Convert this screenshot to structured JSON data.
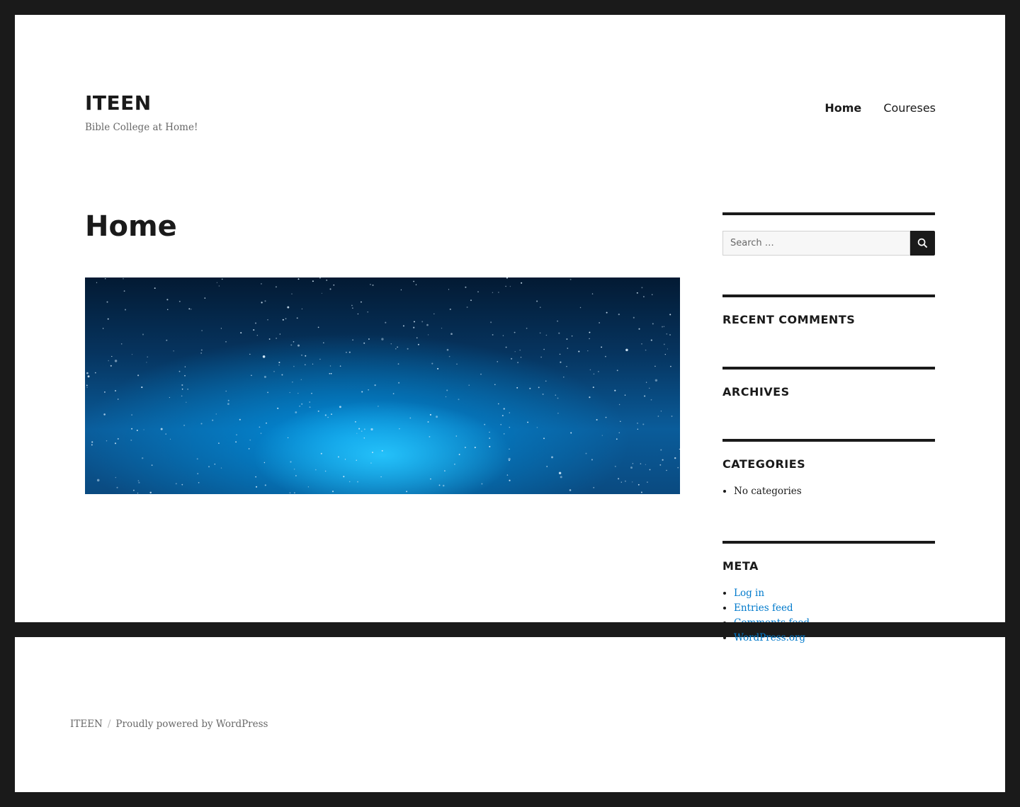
{
  "site": {
    "title": "ITEEN",
    "description": "Bible College at Home!"
  },
  "nav": {
    "items": [
      {
        "label": "Home",
        "current": true
      },
      {
        "label": "Coureses",
        "current": false
      }
    ]
  },
  "main": {
    "title": "Home",
    "hero_image": "starry-night-sky"
  },
  "sidebar": {
    "search": {
      "placeholder": "Search …",
      "button_icon": "search-icon"
    },
    "recent_comments": {
      "title": "RECENT COMMENTS"
    },
    "archives": {
      "title": "ARCHIVES"
    },
    "categories": {
      "title": "CATEGORIES",
      "items": [
        "No categories"
      ]
    },
    "meta": {
      "title": "META",
      "items": [
        "Log in",
        "Entries feed",
        "Comments feed",
        "WordPress.org"
      ]
    }
  },
  "footer": {
    "site_name": "ITEEN",
    "separator": "/",
    "powered": "Proudly powered by WordPress"
  },
  "colors": {
    "link": "#007acc",
    "text": "#1a1a1a",
    "muted": "#686868",
    "frame": "#1a1a1a"
  }
}
